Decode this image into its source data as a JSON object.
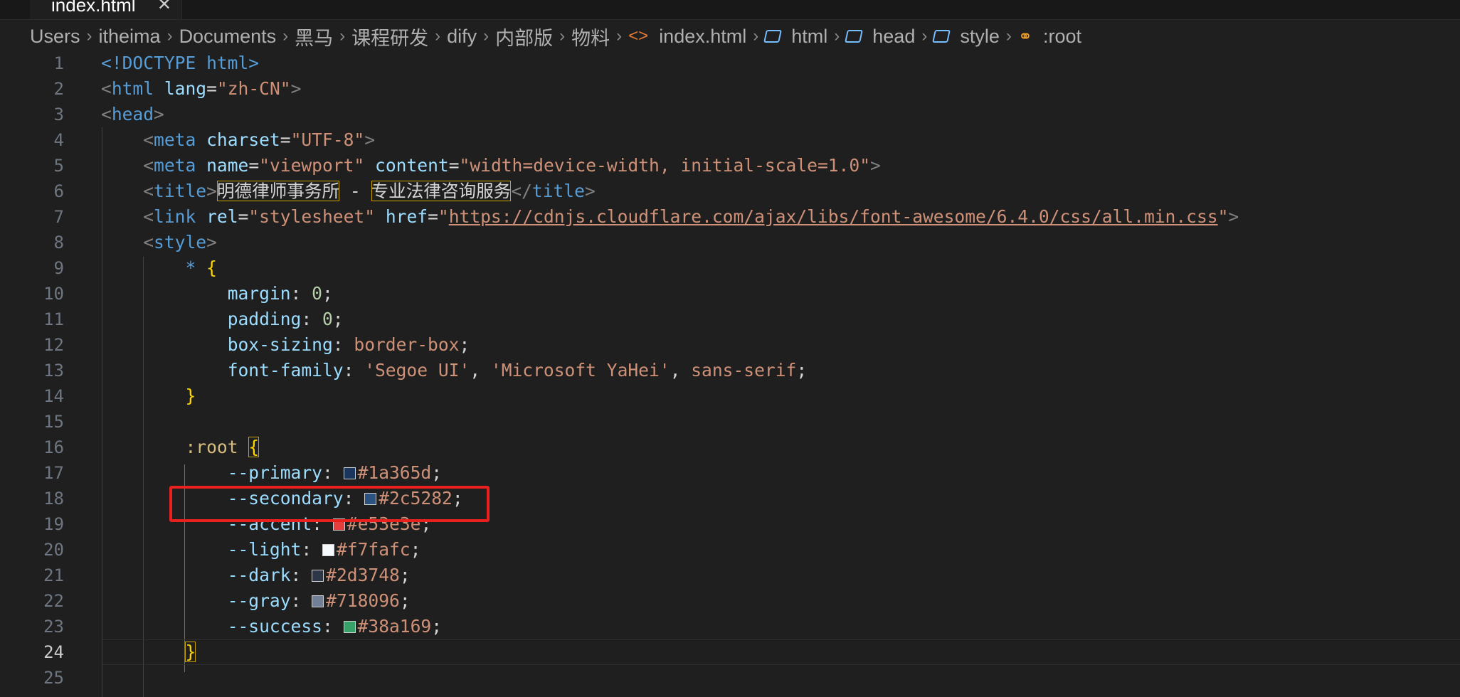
{
  "tab": {
    "label": "index.html",
    "close": "✕"
  },
  "breadcrumb": {
    "items": [
      "Users",
      "itheima",
      "Documents",
      "黑马",
      "课程研发",
      "dify",
      "内部版",
      "物料",
      "index.html",
      "html",
      "head",
      "style",
      ":root"
    ],
    "separator": "›"
  },
  "editor": {
    "line_numbers": [
      "1",
      "2",
      "3",
      "4",
      "5",
      "6",
      "7",
      "8",
      "9",
      "10",
      "11",
      "12",
      "13",
      "14",
      "15",
      "16",
      "17",
      "18",
      "19",
      "20",
      "21",
      "22",
      "23",
      "24",
      "25"
    ],
    "current_line": "24",
    "doctype": "<!DOCTYPE html>",
    "html_lang": "zh-CN",
    "meta_charset": "UTF-8",
    "meta_name": "viewport",
    "meta_content": "width=device-width, initial-scale=1.0",
    "title_part1": "明德律师事务所",
    "title_sep": " - ",
    "title_part2": "专业法律咨询服务",
    "link_rel": "stylesheet",
    "link_href": "https://cdnjs.cloudflare.com/ajax/libs/font-awesome/6.4.0/css/all.min.css",
    "universal_selector": "*",
    "margin": "0",
    "padding": "0",
    "box_sizing": "border-box",
    "font_family_1": "'Segoe UI'",
    "font_family_2": "'Microsoft YaHei'",
    "font_family_3": "sans-serif",
    "root_selector": ":root",
    "vars": [
      {
        "name": "--primary",
        "value": "#1a365d"
      },
      {
        "name": "--secondary",
        "value": "#2c5282"
      },
      {
        "name": "--accent",
        "value": "#e53e3e"
      },
      {
        "name": "--light",
        "value": "#f7fafc"
      },
      {
        "name": "--dark",
        "value": "#2d3748"
      },
      {
        "name": "--gray",
        "value": "#718096"
      },
      {
        "name": "--success",
        "value": "#38a169"
      }
    ]
  },
  "colors": {
    "highlight_box": "#e8211e",
    "editor_bg": "#1f1f1f"
  }
}
